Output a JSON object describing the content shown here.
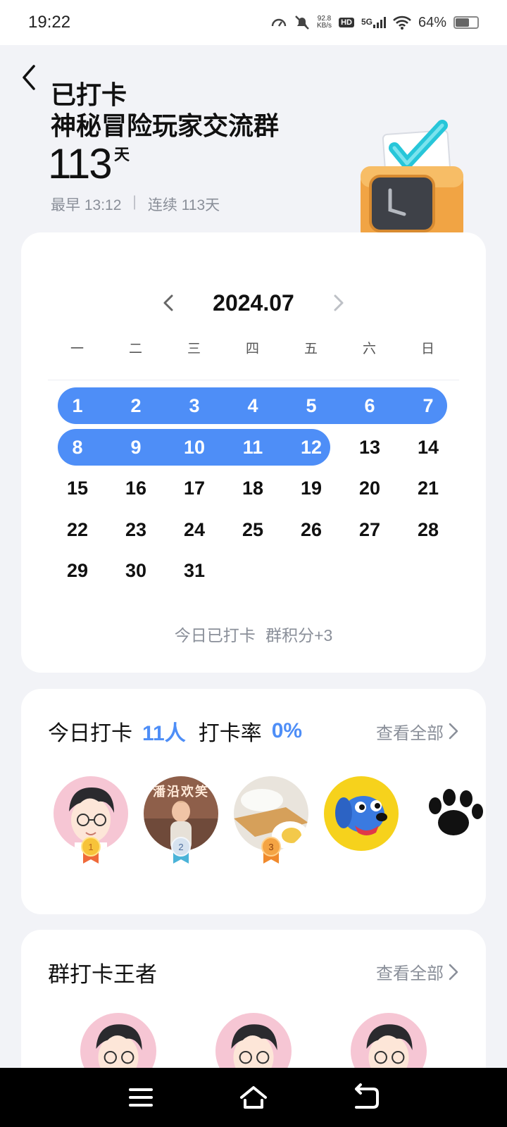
{
  "status_bar": {
    "time": "19:22",
    "speed_value": "92.8",
    "speed_unit": "KB/s",
    "hd": "HD",
    "network": "5G",
    "battery": "64%",
    "battery_level": 0.64
  },
  "header": {
    "status": "已打卡",
    "group_name": "神秘冒险玩家交流群",
    "days": "113",
    "days_unit": "天",
    "earliest": "最早 13:12",
    "separator": "|",
    "streak": "连续 113天"
  },
  "calendar": {
    "month": "2024.07",
    "weekdays": [
      "一",
      "二",
      "三",
      "四",
      "五",
      "六",
      "日"
    ],
    "days": [
      "1",
      "2",
      "3",
      "4",
      "5",
      "6",
      "7",
      "8",
      "9",
      "10",
      "11",
      "12",
      "13",
      "14",
      "15",
      "16",
      "17",
      "18",
      "19",
      "20",
      "21",
      "22",
      "23",
      "24",
      "25",
      "26",
      "27",
      "28",
      "29",
      "30",
      "31"
    ],
    "checked_days": [
      1,
      2,
      3,
      4,
      5,
      6,
      7,
      8,
      9,
      10,
      11,
      12
    ],
    "footer": "今日已打卡 群积分+3"
  },
  "today_checkin": {
    "label": "今日打卡",
    "count": "11人",
    "rate_label": "打卡率",
    "rate": "0%",
    "view_all": "查看全部",
    "avatar_captions": [
      "潘沿欢笑"
    ],
    "medals": [
      "1",
      "2",
      "3"
    ]
  },
  "group_king": {
    "title": "群打卡王者",
    "view_all": "查看全部"
  },
  "colors": {
    "accent": "#4e8ef7",
    "background": "#f2f3f7",
    "muted_text": "#8a8f99"
  },
  "icons": [
    "back-icon",
    "chevron-left-icon",
    "chevron-right-icon",
    "menu-icon",
    "home-icon",
    "return-icon",
    "wifi-icon",
    "mute-bell-icon"
  ]
}
